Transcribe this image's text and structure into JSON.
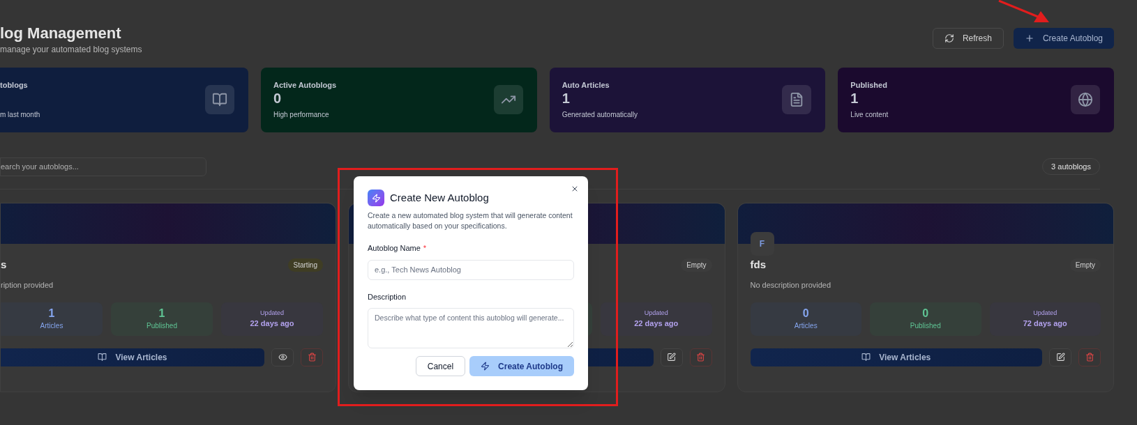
{
  "page": {
    "title": "log Management",
    "subtitle": "manage your automated blog systems"
  },
  "header_buttons": [
    {
      "label": "Refresh",
      "kind": "outline"
    },
    {
      "label": "Create Autoblog",
      "kind": "primary"
    }
  ],
  "stats": [
    {
      "label": "toblogs",
      "sublabel": "m last month",
      "color": "#0f1e3e"
    },
    {
      "label": "Active Autoblogs",
      "value": "0",
      "sublabel": "High performance",
      "color": "#03271b"
    },
    {
      "label": "Auto Articles",
      "value": "1",
      "sublabel": "Generated automatically",
      "color": "#1c1338"
    },
    {
      "label": "Published",
      "value": "1",
      "sublabel": "Live content",
      "color": "#1b0a2e"
    }
  ],
  "search": {
    "placeholder": "earch your autoblogs..."
  },
  "count_badge": "3 autoblogs",
  "autoblogs": [
    {
      "name": "s",
      "description": "ription provided",
      "status": "Starting",
      "color": "#3f3d24",
      "articles": "1",
      "articles_label": "Articles",
      "published": "1",
      "published_label": "Published",
      "updated_label": "Updated",
      "updated": "22 days ago",
      "view_button": "View Articles",
      "actions": [
        {
          "kind": "view"
        },
        {
          "kind": "delete"
        }
      ]
    },
    {
      "status": "Empty",
      "color": "#3c3c3c",
      "updated_label": "Updated",
      "updated": "22 days ago",
      "actions": [
        {
          "kind": "edit"
        },
        {
          "kind": "delete"
        }
      ]
    },
    {
      "avatar": "F",
      "name": "fds",
      "description": "No description provided",
      "status": "Empty",
      "color": "#3c3c3c",
      "articles": "0",
      "articles_label": "Articles",
      "published": "0",
      "published_label": "Published",
      "updated_label": "Updated",
      "updated": "72 days ago",
      "view_button": "View Articles",
      "actions": [
        {
          "kind": "edit"
        },
        {
          "kind": "delete"
        }
      ]
    }
  ],
  "dialog": {
    "title": "Create New Autoblog",
    "description": "Create a new automated blog system that will generate content automatically based on your specifications.",
    "fields": [
      {
        "label": "Autoblog Name",
        "required_mark": "*",
        "kind": "input",
        "placeholder": "e.g., Tech News Autoblog"
      },
      {
        "label": "Description",
        "kind": "textarea",
        "placeholder": "Describe what type of content this autoblog will generate..."
      }
    ],
    "buttons": [
      {
        "label": "Cancel",
        "kind": "secondary",
        "disabled": false
      },
      {
        "label": "Create Autoblog",
        "kind": "primary",
        "disabled": true
      }
    ]
  }
}
